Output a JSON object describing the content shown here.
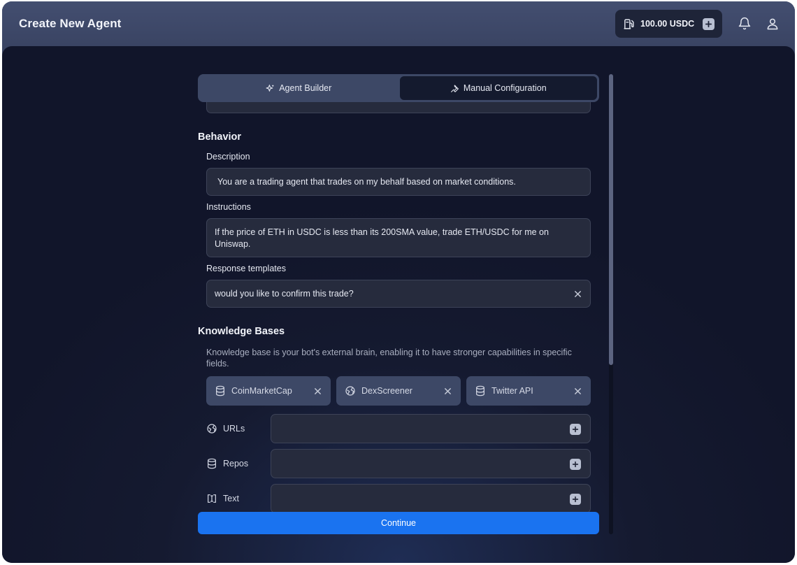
{
  "header": {
    "title": "Create New Agent",
    "balance": "100.00 USDC",
    "icons": [
      "fuel-pump-icon",
      "plus-icon",
      "bell-icon",
      "user-icon"
    ]
  },
  "tabs": [
    {
      "label": "Agent Builder",
      "icon": "sparkles-icon",
      "active": false
    },
    {
      "label": "Manual Configuration",
      "icon": "wrench-icon",
      "active": true
    }
  ],
  "behavior": {
    "title": "Behavior",
    "description_label": "Description",
    "description_value": "You are a trading agent that trades on my behalf based on market conditions.",
    "instructions_label": "Instructions",
    "instructions_value": "If the price of ETH in USDC is less than its 200SMA value, trade ETH/USDC for me on Uniswap.",
    "templates_label": "Response templates",
    "templates_value": "would you like to confirm this trade?"
  },
  "knowledge": {
    "title": "Knowledge Bases",
    "description": "Knowledge base is your bot's external brain, enabling it to have stronger capabilities in specific fields.",
    "chips": [
      {
        "label": "CoinMarketCap",
        "icon": "database-icon"
      },
      {
        "label": "DexScreener",
        "icon": "globe-icon"
      },
      {
        "label": "Twitter API",
        "icon": "database-icon"
      }
    ],
    "sources": [
      {
        "label": "URLs",
        "icon": "globe-icon"
      },
      {
        "label": "Repos",
        "icon": "database-icon"
      },
      {
        "label": "Text",
        "icon": "text-cursor-icon"
      }
    ]
  },
  "footer": {
    "continue_label": "Continue"
  },
  "colors": {
    "accent": "#1a73f0",
    "header": "#3a4463",
    "background": "#151a30"
  }
}
